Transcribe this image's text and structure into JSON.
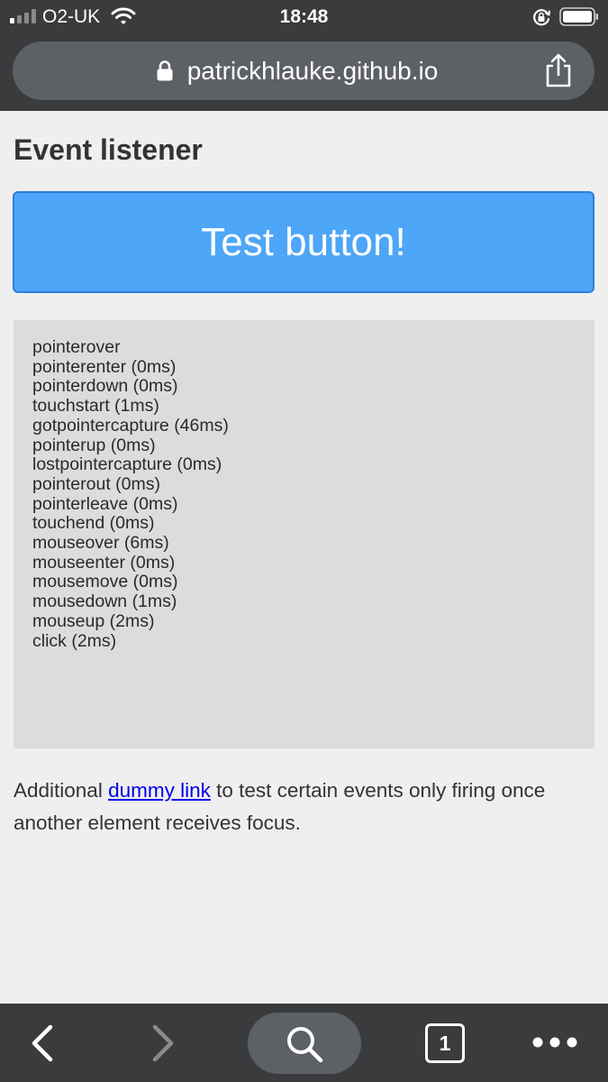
{
  "status_bar": {
    "carrier": "O2-UK",
    "time": "18:48"
  },
  "browser": {
    "url": "patrickhlauke.github.io"
  },
  "page": {
    "title": "Event listener",
    "button_label": "Test button!",
    "events_log": [
      "pointerover",
      "pointerenter (0ms)",
      "pointerdown (0ms)",
      "touchstart (1ms)",
      "gotpointercapture (46ms)",
      "pointerup (0ms)",
      "lostpointercapture (0ms)",
      "pointerout (0ms)",
      "pointerleave (0ms)",
      "touchend (0ms)",
      "mouseover (6ms)",
      "mouseenter (0ms)",
      "mousemove (0ms)",
      "mousedown (1ms)",
      "mouseup (2ms)",
      "click (2ms)"
    ],
    "footer": {
      "before": "Additional ",
      "link": "dummy link",
      "after": " to test certain events only firing once another element receives focus."
    }
  },
  "toolbar": {
    "tab_count": "1"
  },
  "icons": {
    "status_bar": [
      "signal-icon",
      "wifi-icon",
      "rotation-lock-icon",
      "battery-icon"
    ],
    "browser": [
      "lock-icon",
      "share-icon"
    ],
    "toolbar": [
      "back-icon",
      "forward-icon",
      "search-icon",
      "tabs-icon",
      "more-icon"
    ]
  },
  "colors": {
    "chrome": "#3a3b3d",
    "url_bar": "#5d6064",
    "button": "#4da6f8",
    "button_border": "#2e7fd8",
    "log_background": "#dcdcdc",
    "page_background": "#efefef",
    "link": "#0000ee"
  }
}
